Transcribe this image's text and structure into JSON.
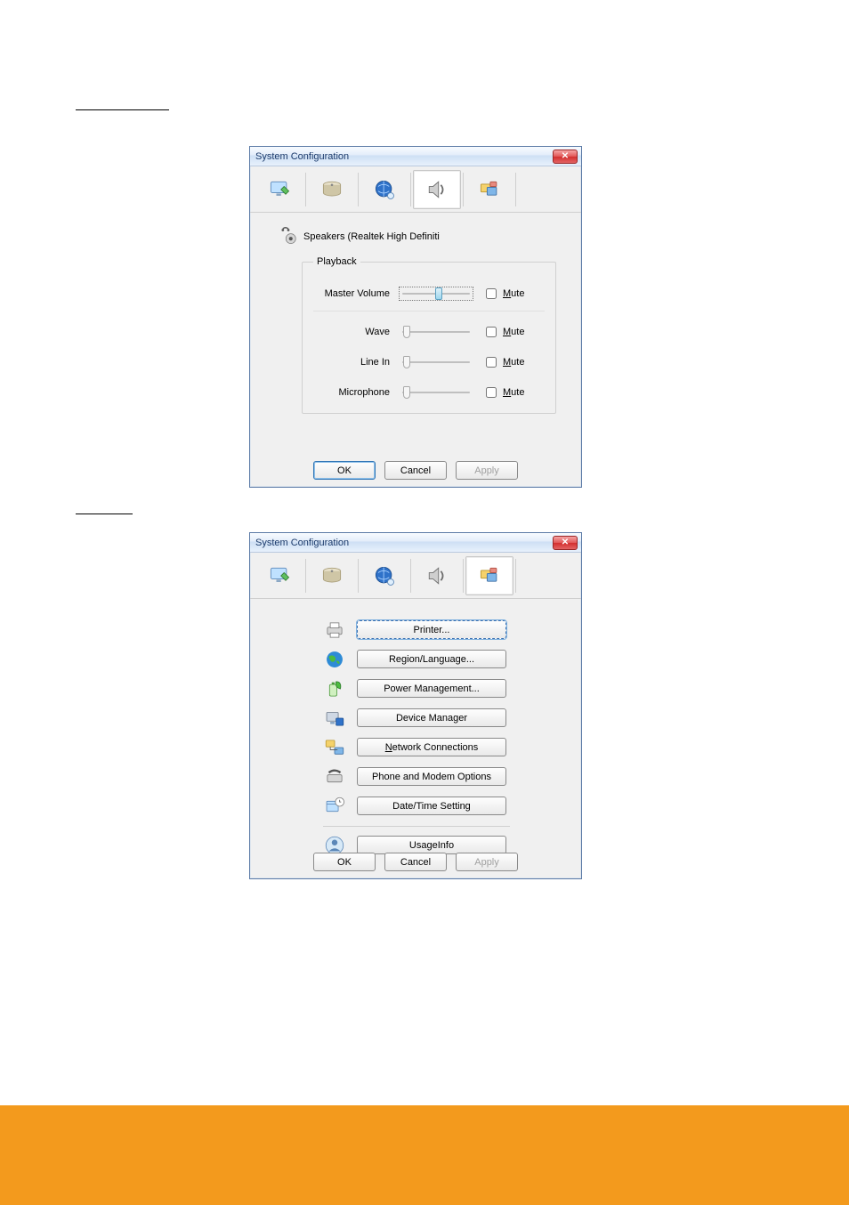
{
  "headings": {
    "audio": "",
    "others": ""
  },
  "window_title": "System Configuration",
  "close_glyph": "✕",
  "ok": "OK",
  "cancel": "Cancel",
  "apply": "Apply",
  "audio": {
    "device": "Speakers (Realtek High Definiti",
    "group": "Playback",
    "master": "Master Volume",
    "wave": "Wave",
    "linein": "Line In",
    "mic": "Microphone",
    "mute_pre": "M",
    "mute_suf": "ute",
    "master_val": 55,
    "wave_val": 2,
    "linein_val": 2,
    "mic_val": 2
  },
  "others": {
    "printer": "Printer...",
    "region": "Region/Language...",
    "power": "Power Management...",
    "devmgr": "Device Manager",
    "net_pre": "N",
    "net_suf": "etwork Connections",
    "modem": "Phone and Modem Options",
    "datetime": "Date/Time Setting",
    "usage": "UsageInfo"
  }
}
